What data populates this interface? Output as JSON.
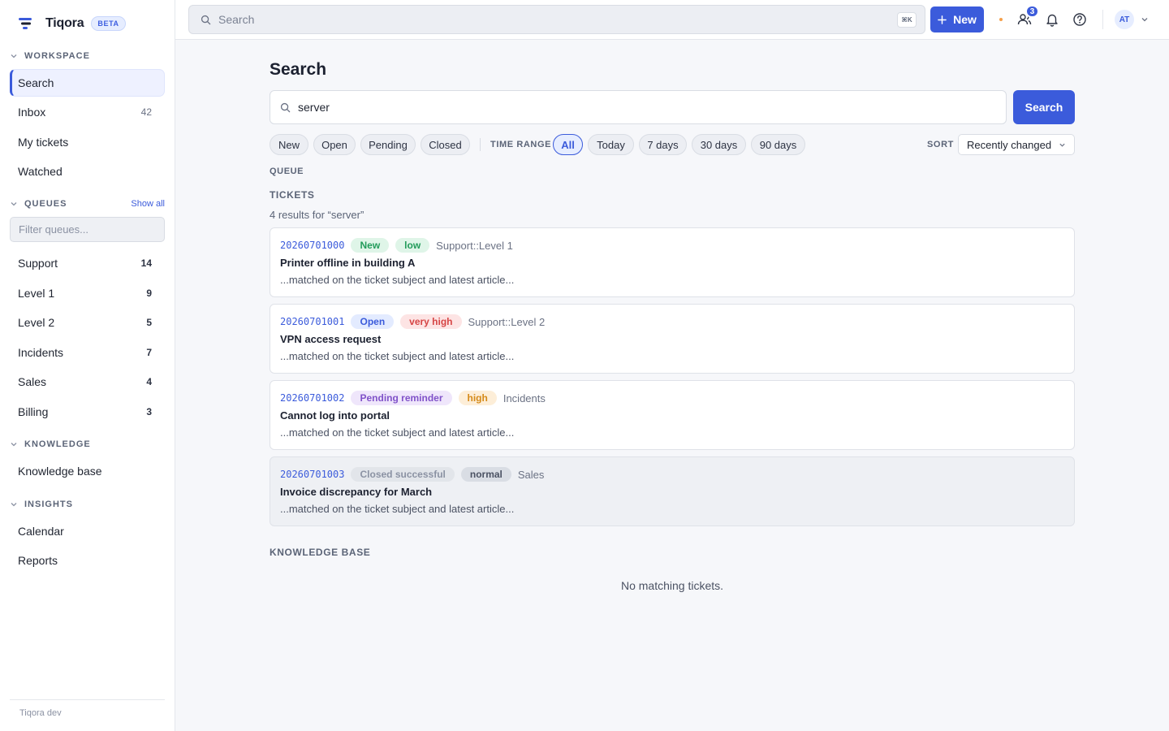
{
  "brand": {
    "name": "Tiqora",
    "badge": "BETA"
  },
  "sidebar": {
    "workspace_label": "WORKSPACE",
    "workspace": [
      {
        "label": "Search",
        "count": ""
      },
      {
        "label": "Inbox",
        "count": "42"
      },
      {
        "label": "My tickets",
        "count": ""
      },
      {
        "label": "Watched",
        "count": ""
      }
    ],
    "queues_label": "QUEUES",
    "show_all": "Show all",
    "filter_placeholder": "Filter queues...",
    "queues": [
      {
        "label": "Support",
        "count": "14"
      },
      {
        "label": "Level 1",
        "count": "9"
      },
      {
        "label": "Level 2",
        "count": "5"
      },
      {
        "label": "Incidents",
        "count": "7"
      },
      {
        "label": "Sales",
        "count": "4"
      },
      {
        "label": "Billing",
        "count": "3"
      }
    ],
    "knowledge_label": "KNOWLEDGE",
    "knowledge": [
      {
        "label": "Knowledge base"
      }
    ],
    "insights_label": "INSIGHTS",
    "insights": [
      {
        "label": "Calendar"
      },
      {
        "label": "Reports"
      }
    ],
    "footer": "Tiqora dev"
  },
  "topbar": {
    "search_placeholder": "Search",
    "shortcut": "⌘K",
    "new_label": "New",
    "notification_count": "3",
    "avatar_initials": "AT"
  },
  "main": {
    "title": "Search",
    "query": "server",
    "search_button": "Search",
    "state_filters": [
      "New",
      "Open",
      "Pending",
      "Closed"
    ],
    "time_range_label": "TIME RANGE",
    "time_ranges": [
      "All",
      "Today",
      "7 days",
      "30 days",
      "90 days"
    ],
    "active_time_range": "All",
    "sort_label": "SORT",
    "sort_value": "Recently changed",
    "queue_heading": "QUEUE",
    "tickets_heading": "TICKETS",
    "results_count": "4 results for “server”",
    "tickets": [
      {
        "number": "20260701000",
        "state": "New",
        "state_bg": "#dff5e8",
        "state_fg": "#229b5a",
        "priority": "low",
        "priority_bg": "#dff5e8",
        "priority_fg": "#229b5a",
        "queue": "Support::Level 1",
        "title": "Printer offline in building A",
        "snippet": "...matched on the ticket subject and latest article..."
      },
      {
        "number": "20260701001",
        "state": "Open",
        "state_bg": "#e3ebff",
        "state_fg": "#3b5bdb",
        "priority": "very high",
        "priority_bg": "#fde4e4",
        "priority_fg": "#d64545",
        "queue": "Support::Level 2",
        "title": "VPN access request",
        "snippet": "...matched on the ticket subject and latest article..."
      },
      {
        "number": "20260701002",
        "state": "Pending reminder",
        "state_bg": "#efe6fb",
        "state_fg": "#8052c9",
        "priority": "high",
        "priority_bg": "#fdeed8",
        "priority_fg": "#d58a19",
        "queue": "Incidents",
        "title": "Cannot log into portal",
        "snippet": "...matched on the ticket subject and latest article..."
      },
      {
        "number": "20260701003",
        "state": "Closed successful",
        "state_bg": "#e2e5ea",
        "state_fg": "#8b92a3",
        "priority": "normal",
        "priority_bg": "#d9dde4",
        "priority_fg": "#4b5263",
        "queue": "Sales",
        "title": "Invoice discrepancy for March",
        "snippet": "...matched on the ticket subject and latest article..."
      }
    ],
    "kb_heading": "KNOWLEDGE BASE",
    "kb_empty": "No matching tickets."
  }
}
